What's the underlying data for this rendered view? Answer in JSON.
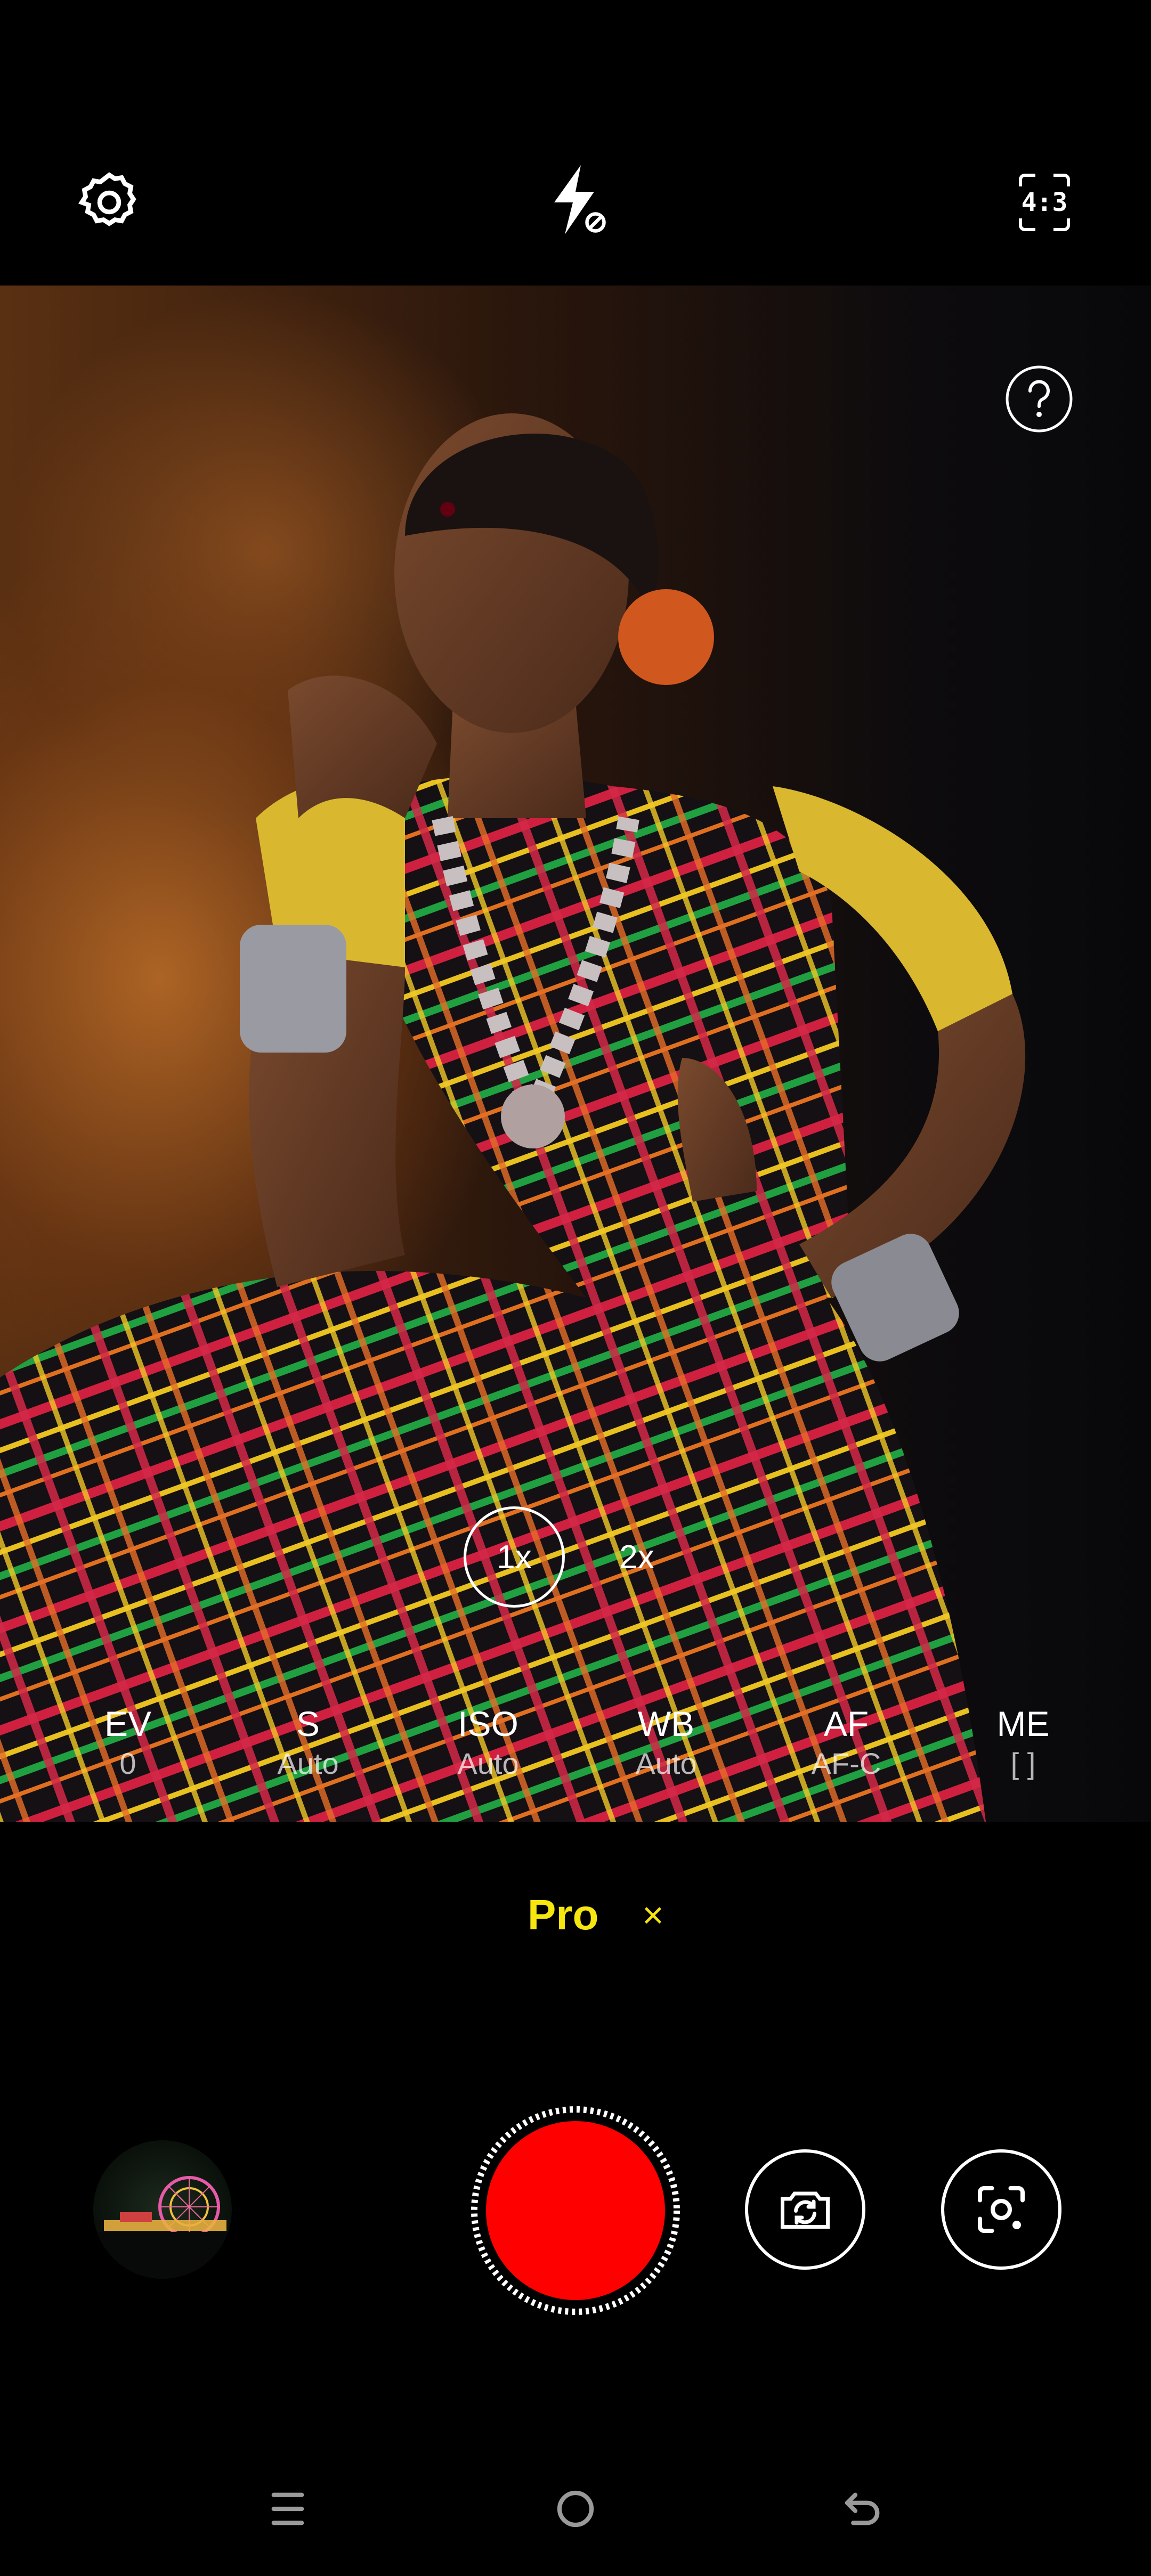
{
  "top_bar": {
    "settings_icon": "gear-icon",
    "flash_icon": "flash-off-icon",
    "aspect_ratio_label": "4:3"
  },
  "viewfinder": {
    "help_icon": "question-mark-icon",
    "zoom": {
      "active": "1x",
      "other": "2x"
    }
  },
  "pro_params": [
    {
      "name": "EV",
      "value": "0"
    },
    {
      "name": "S",
      "value": "Auto"
    },
    {
      "name": "ISO",
      "value": "Auto"
    },
    {
      "name": "WB",
      "value": "Auto"
    },
    {
      "name": "AF",
      "value": "AF-C"
    },
    {
      "name": "ME",
      "value": "[ ]"
    }
  ],
  "mode": {
    "label": "Pro",
    "close": "×"
  },
  "bottom_controls": {
    "gallery_icon": "gallery-thumbnail",
    "shutter_color": "#ff0000",
    "switch_camera_icon": "switch-camera-icon",
    "lens_icon": "scan-lens-icon"
  },
  "nav_bar": {
    "menu_icon": "menu-icon",
    "home_icon": "home-icon",
    "back_icon": "back-icon"
  },
  "colors": {
    "mode_accent": "#f5e60f",
    "shutter": "#ff0000"
  }
}
